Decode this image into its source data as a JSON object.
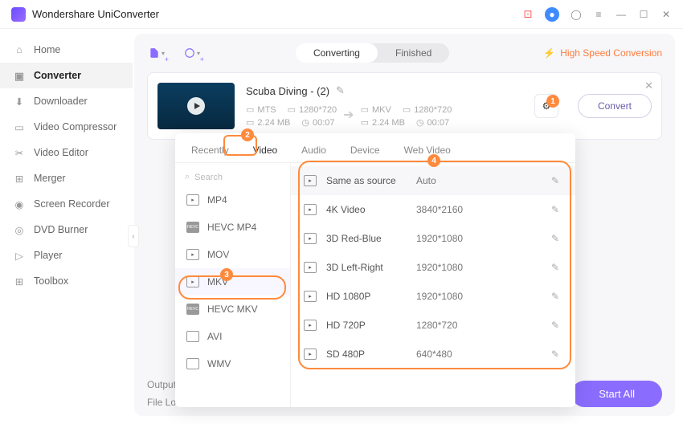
{
  "app": {
    "title": "Wondershare UniConverter"
  },
  "titlebar": {
    "gift": "gift-icon",
    "user": "user-icon",
    "help": "headset-icon",
    "menu": "menu-icon"
  },
  "sidebar": {
    "items": [
      {
        "label": "Home"
      },
      {
        "label": "Converter"
      },
      {
        "label": "Downloader"
      },
      {
        "label": "Video Compressor"
      },
      {
        "label": "Video Editor"
      },
      {
        "label": "Merger"
      },
      {
        "label": "Screen Recorder"
      },
      {
        "label": "DVD Burner"
      },
      {
        "label": "Player"
      },
      {
        "label": "Toolbox"
      }
    ]
  },
  "toolbar": {
    "segments": {
      "converting": "Converting",
      "finished": "Finished"
    },
    "hsconv": "High Speed Conversion"
  },
  "card": {
    "filename": "Scuba Diving - (2)",
    "src": {
      "fmt": "MTS",
      "res": "1280*720",
      "size": "2.24 MB",
      "dur": "00:07"
    },
    "dst": {
      "fmt": "MKV",
      "res": "1280*720",
      "size": "2.24 MB",
      "dur": "00:07"
    },
    "convert": "Convert"
  },
  "popup": {
    "tabs": [
      "Recently",
      "Video",
      "Audio",
      "Device",
      "Web Video"
    ],
    "search_placeholder": "Search",
    "formats": [
      "MP4",
      "HEVC MP4",
      "MOV",
      "MKV",
      "HEVC MKV",
      "AVI",
      "WMV"
    ],
    "resolutions": [
      {
        "name": "Same as source",
        "val": "Auto"
      },
      {
        "name": "4K Video",
        "val": "3840*2160"
      },
      {
        "name": "3D Red-Blue",
        "val": "1920*1080"
      },
      {
        "name": "3D Left-Right",
        "val": "1920*1080"
      },
      {
        "name": "HD 1080P",
        "val": "1920*1080"
      },
      {
        "name": "HD 720P",
        "val": "1280*720"
      },
      {
        "name": "SD 480P",
        "val": "640*480"
      }
    ]
  },
  "footer": {
    "output": "Output",
    "fileloc": "File Loc",
    "startall": "Start All"
  },
  "badges": {
    "b1": "1",
    "b2": "2",
    "b3": "3",
    "b4": "4"
  }
}
